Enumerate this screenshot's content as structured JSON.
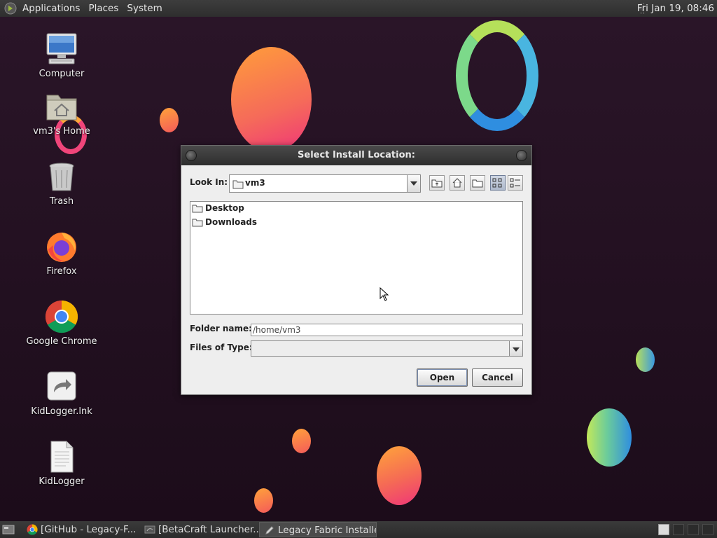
{
  "top_panel": {
    "menus": [
      "Applications",
      "Places",
      "System"
    ],
    "clock": "Fri Jan 19, 08:46"
  },
  "desktop_icons": [
    {
      "label": "Computer",
      "icon": "computer-icon"
    },
    {
      "label": "vm3's Home",
      "icon": "home-folder-icon"
    },
    {
      "label": "Trash",
      "icon": "trash-icon"
    },
    {
      "label": "Firefox",
      "icon": "firefox-icon"
    },
    {
      "label": "Google Chrome",
      "icon": "chrome-icon"
    },
    {
      "label": "KidLogger.lnk",
      "icon": "shortcut-icon"
    },
    {
      "label": "KidLogger",
      "icon": "text-file-icon"
    }
  ],
  "dialog": {
    "title": "Select Install Location:",
    "look_in_label": "Look In:",
    "look_in_value": "vm3",
    "toolbar_icons": [
      "up-folder-icon",
      "home-icon",
      "new-folder-icon",
      "list-view-icon",
      "details-view-icon"
    ],
    "files": [
      "Desktop",
      "Downloads"
    ],
    "folder_name_label": "Folder name:",
    "folder_name_value": "/home/vm3",
    "files_of_type_label": "Files of Type:",
    "files_of_type_value": "",
    "open_label": "Open",
    "cancel_label": "Cancel"
  },
  "taskbar": {
    "items": [
      {
        "label": "[GitHub - Legacy-F...",
        "icon": "chrome-icon",
        "active": false
      },
      {
        "label": "[BetaCraft Launcher...",
        "icon": "java-icon",
        "active": false
      },
      {
        "label": "Legacy Fabric Installer",
        "icon": "pencil-icon",
        "active": true
      }
    ]
  },
  "colors": {
    "wallpaper": "#21101f",
    "panel": "#333333",
    "dialog_bg": "#eeeeee",
    "accent_orange": "#f97a35",
    "accent_pink": "#f0357a"
  }
}
